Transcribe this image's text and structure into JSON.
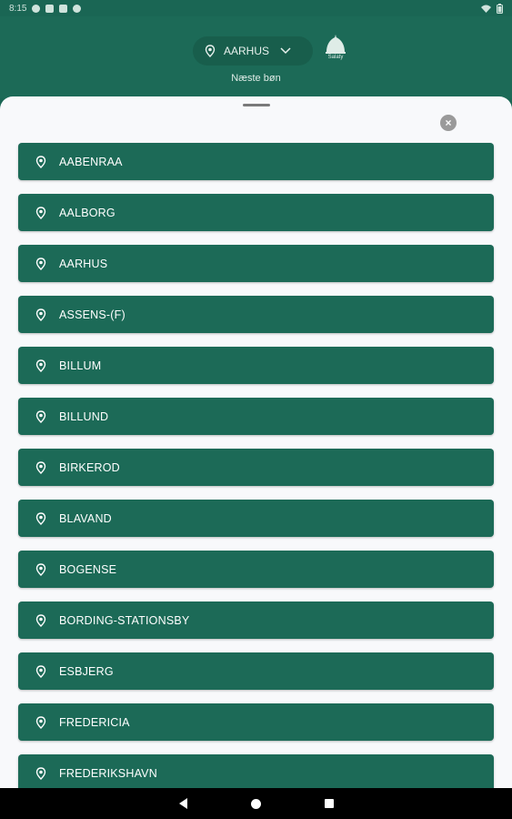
{
  "status_bar": {
    "time": "8:15",
    "left_icons": [
      "a-icon",
      "notification-icon",
      "mail-icon",
      "app-icon"
    ],
    "right_icons": [
      "wifi-icon",
      "battery-icon"
    ]
  },
  "header": {
    "selected_city": "AARHUS",
    "salaty_label": "Salaty",
    "next_prayer_label": "Næste bøn"
  },
  "sheet": {
    "close_icon": "close-icon",
    "cities": [
      "AABENRAA",
      "AALBORG",
      "AARHUS",
      "ASSENS-(F)",
      "BILLUM",
      "BILLUND",
      "BIRKEROD",
      "BLAVAND",
      "BOGENSE",
      "BORDING-STATIONSBY",
      "ESBJERG",
      "FREDERICIA",
      "FREDERIKSHAVN"
    ]
  },
  "colors": {
    "primary": "#1c6a57",
    "sheet_bg": "#f8f9fb",
    "text_on_primary": "#ffffff"
  }
}
